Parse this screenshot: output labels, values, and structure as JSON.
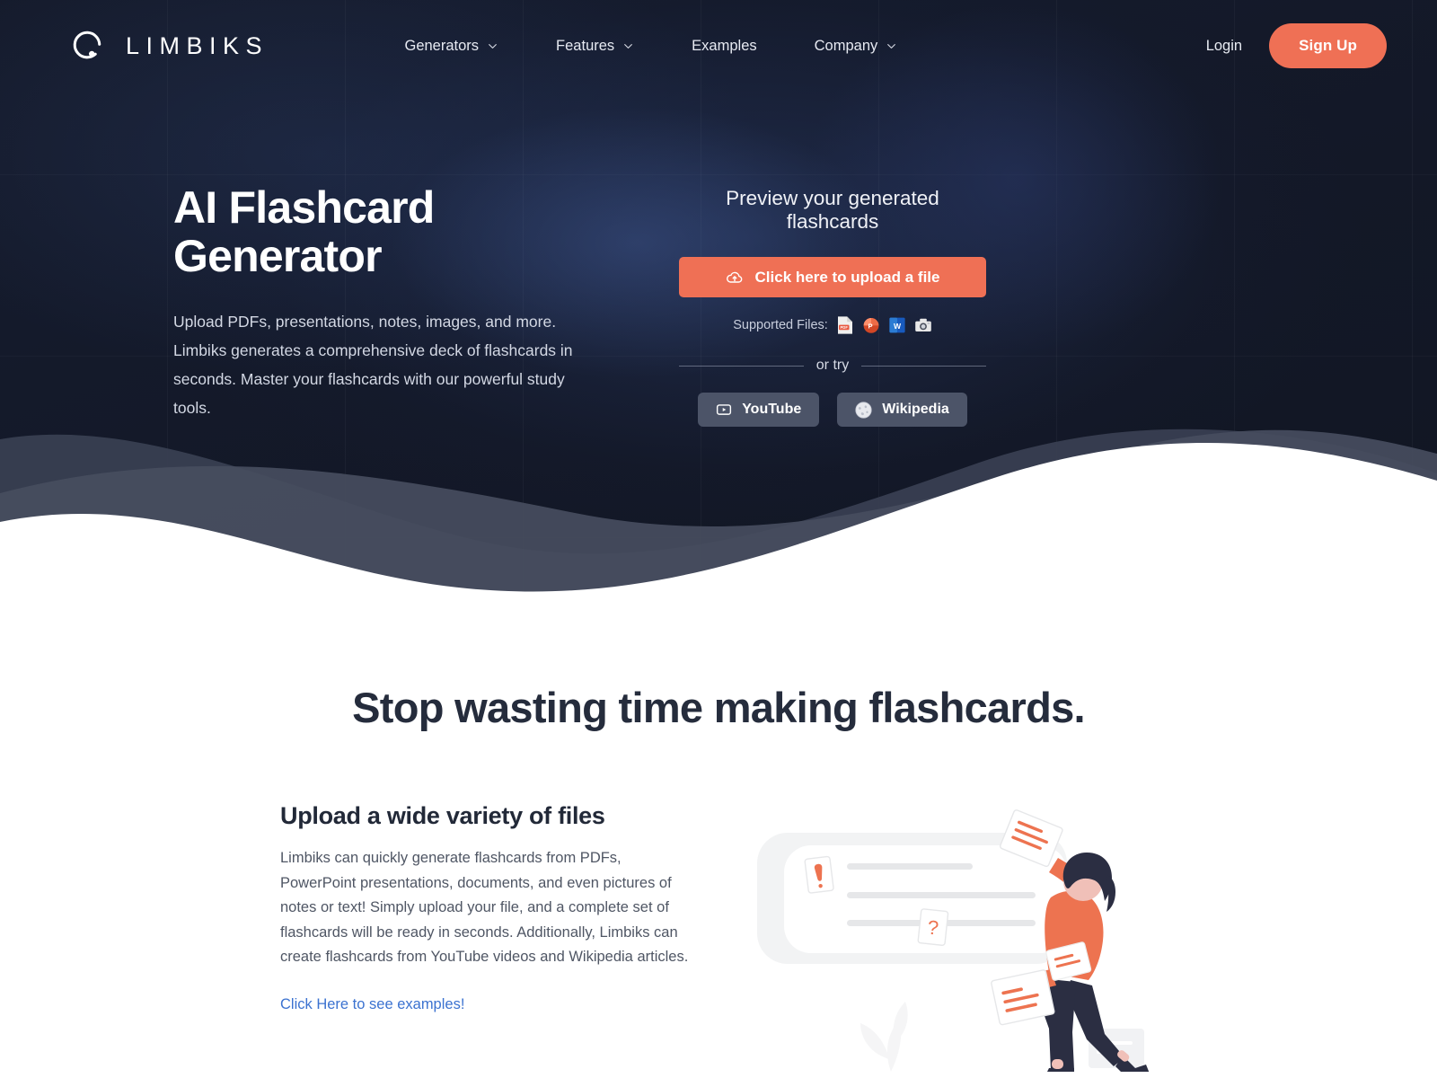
{
  "brand": {
    "name": "LIMBIKS",
    "logo_icon": "limbiks-q-logo"
  },
  "nav": {
    "links": [
      {
        "label": "Generators",
        "has_dropdown": true
      },
      {
        "label": "Features",
        "has_dropdown": true
      },
      {
        "label": "Examples",
        "has_dropdown": false
      },
      {
        "label": "Company",
        "has_dropdown": true
      }
    ],
    "login_label": "Login",
    "signup_label": "Sign Up"
  },
  "hero": {
    "title": "AI Flashcard Generator",
    "subtitle": "Upload PDFs, presentations, notes, images, and more. Limbiks generates a comprehensive deck of flashcards in seconds. Master your flashcards with our powerful study tools.",
    "preview_title": "Preview your generated flashcards",
    "upload_button": "Click here to upload a file",
    "upload_icon": "cloud-upload-icon",
    "supported_label": "Supported Files:",
    "supported_files": [
      {
        "name": "pdf-file-icon",
        "label": "PDF"
      },
      {
        "name": "powerpoint-file-icon",
        "label": "P"
      },
      {
        "name": "word-file-icon",
        "label": "W"
      },
      {
        "name": "camera-photo-icon",
        "label": "Photo"
      }
    ],
    "divider_text": "or try",
    "try_buttons": [
      {
        "label": "YouTube",
        "icon": "youtube-icon"
      },
      {
        "label": "Wikipedia",
        "icon": "wikipedia-globe-icon"
      }
    ]
  },
  "section2": {
    "heading": "Stop wasting time making flashcards.",
    "feature_title": "Upload a wide variety of files",
    "feature_body": "Limbiks can quickly generate flashcards from PDFs, PowerPoint presentations, documents, and even pictures of notes or text! Simply upload your file, and a complete set of flashcards will be ready in seconds. Additionally, Limbiks can create flashcards from YouTube videos and Wikipedia articles.",
    "feature_link": "Click Here to see examples!",
    "illustration": {
      "name": "person-uploading-documents-illustration",
      "card_marks": [
        "!",
        "?"
      ]
    }
  },
  "colors": {
    "accent": "#ef7055",
    "hero_bg": "#131827",
    "link": "#3b72d0",
    "heading": "#252c3c",
    "try_button_bg": "#4c5468"
  }
}
